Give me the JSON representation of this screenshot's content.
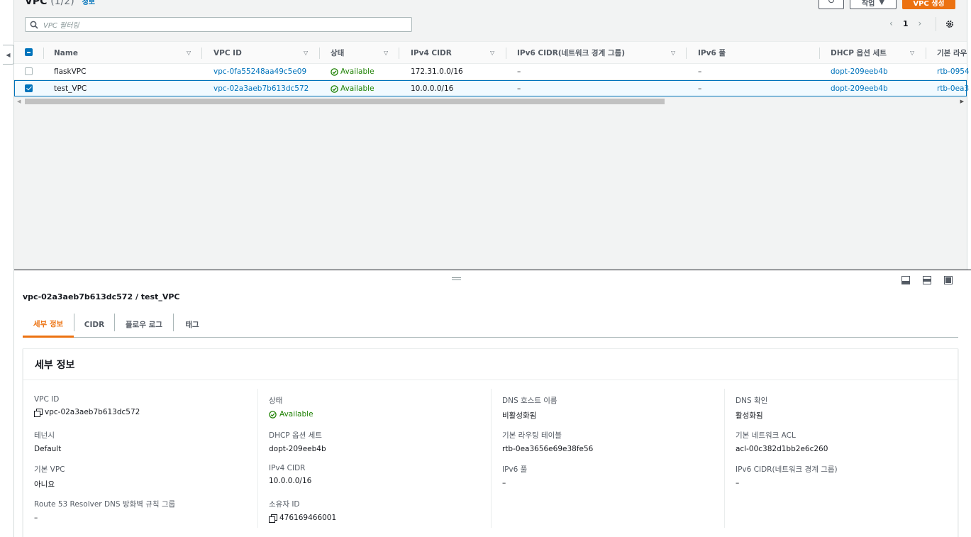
{
  "header": {
    "title": "VPC",
    "count": "(1/2)",
    "info": "정보",
    "actions_label": "작업",
    "create_label": "VPC 생성"
  },
  "filter": {
    "placeholder": "VPC 필터링"
  },
  "pager": {
    "page": "1"
  },
  "columns": [
    "Name",
    "VPC ID",
    "상태",
    "IPv4 CIDR",
    "IPv6 CIDR(네트워크 경계 그룹)",
    "IPv6 풀",
    "DHCP 옵션 세트",
    "기본 라우"
  ],
  "rows": [
    {
      "name": "flaskVPC",
      "vpc_id": "vpc-0fa55248aa49c5e09",
      "status": "Available",
      "ipv4": "172.31.0.0/16",
      "ipv6": "–",
      "ipv6pool": "–",
      "dhcp": "dopt-209eeb4b",
      "route": "rtb-0954",
      "selected": false
    },
    {
      "name": "test_VPC",
      "vpc_id": "vpc-02a3aeb7b613dc572",
      "status": "Available",
      "ipv4": "10.0.0.0/16",
      "ipv6": "–",
      "ipv6pool": "–",
      "dhcp": "dopt-209eeb4b",
      "route": "rtb-0ea3",
      "selected": true
    }
  ],
  "detail": {
    "title": "vpc-02a3aeb7b613dc572 / test_VPC",
    "tabs": [
      "세부 정보",
      "CIDR",
      "플로우 로그",
      "태그"
    ],
    "card_title": "세부 정보",
    "fields": {
      "vpc_id_label": "VPC ID",
      "vpc_id": "vpc-02a3aeb7b613dc572",
      "tenancy_label": "테넌시",
      "tenancy": "Default",
      "default_vpc_label": "기본 VPC",
      "default_vpc": "아니요",
      "route53_label": "Route 53 Resolver DNS 방화벽 규칙 그룹",
      "route53": "–",
      "state_label": "상태",
      "state": "Available",
      "dhcp_label": "DHCP 옵션 세트",
      "dhcp": "dopt-209eeb4b",
      "ipv4_label": "IPv4 CIDR",
      "ipv4": "10.0.0.0/16",
      "owner_label": "소유자 ID",
      "owner": "476169466001",
      "dns_host_label": "DNS 호스트 이름",
      "dns_host": "비활성화됨",
      "main_rt_label": "기본 라우팅 테이블",
      "main_rt": "rtb-0ea3656e69e38fe56",
      "ipv6pool_label": "IPv6 풀",
      "ipv6pool": "–",
      "dns_res_label": "DNS 확인",
      "dns_res": "활성화됨",
      "acl_label": "기본 네트워크 ACL",
      "acl": "acl-00c382d1bb2e6c260",
      "ipv6cidr_label": "IPv6 CIDR(네트워크 경계 그룹)",
      "ipv6cidr": "–"
    }
  },
  "colors": {
    "accent": "#ec7211",
    "link": "#0073bb",
    "ok": "#1d8102"
  }
}
